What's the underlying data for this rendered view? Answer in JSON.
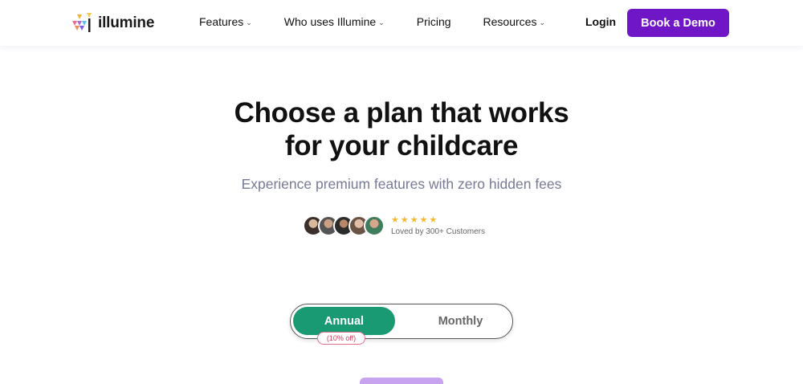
{
  "nav": {
    "logo_text": "illumine",
    "items": [
      {
        "label": "Features",
        "dropdown": true
      },
      {
        "label": "Who uses Illumine",
        "dropdown": true
      },
      {
        "label": "Pricing",
        "dropdown": false
      },
      {
        "label": "Resources",
        "dropdown": true
      }
    ],
    "login_label": "Login",
    "demo_label": "Book a Demo"
  },
  "hero": {
    "title_line1": "Choose a plan that works",
    "title_line2": "for your childcare",
    "subtitle": "Experience premium features with zero hidden fees"
  },
  "social": {
    "stars": "★★★★★",
    "loved_text": "Loved by 300+ Customers"
  },
  "billing": {
    "annual_label": "Annual",
    "monthly_label": "Monthly",
    "discount_badge": "(10% off)",
    "selected": "Annual"
  },
  "colors": {
    "brand_purple": "#6f16c7",
    "toggle_green": "#1a9a72",
    "star_yellow": "#f5b82e",
    "badge_red": "#d43d5f"
  }
}
